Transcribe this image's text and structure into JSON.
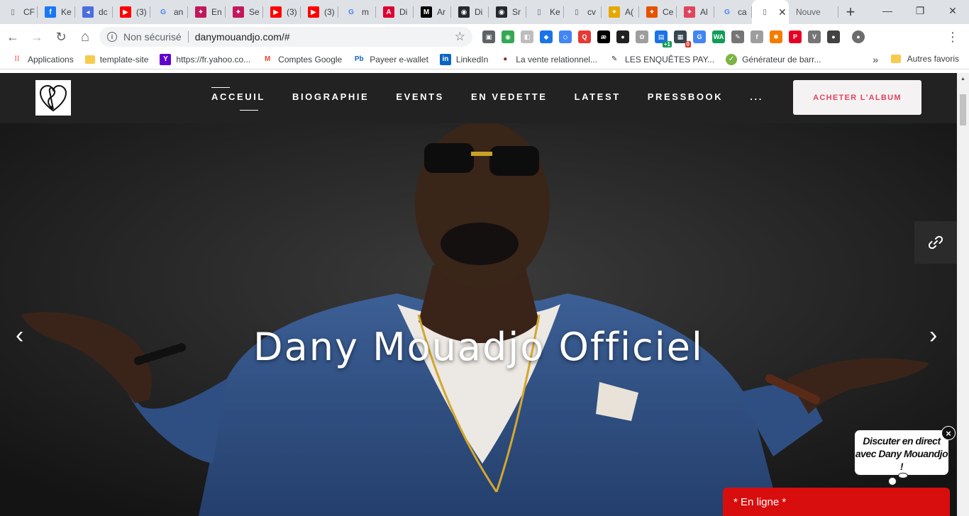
{
  "browser": {
    "tabs": [
      {
        "title": "CF",
        "icon": "page-icon",
        "color": "#5f6368"
      },
      {
        "title": "Ke",
        "icon": "facebook-icon",
        "color": "#1877f2"
      },
      {
        "title": "dc",
        "icon": "dc-icon",
        "color": "#4a6ee0"
      },
      {
        "title": "(3)",
        "icon": "youtube-icon",
        "color": "#ff0000"
      },
      {
        "title": "an",
        "icon": "google-icon",
        "color": "#4285f4"
      },
      {
        "title": "En",
        "icon": "brand-icon",
        "color": "#c2185b"
      },
      {
        "title": "Se",
        "icon": "brand-icon",
        "color": "#c2185b"
      },
      {
        "title": "(3)",
        "icon": "youtube-icon",
        "color": "#ff0000"
      },
      {
        "title": "(3)",
        "icon": "youtube-icon",
        "color": "#ff0000"
      },
      {
        "title": "m",
        "icon": "google-icon",
        "color": "#4285f4"
      },
      {
        "title": "Di",
        "icon": "angular-icon",
        "color": "#dd0031"
      },
      {
        "title": "Ar",
        "icon": "medium-icon",
        "color": "#000000"
      },
      {
        "title": "Di",
        "icon": "github-icon",
        "color": "#24292e"
      },
      {
        "title": "Sr",
        "icon": "github-icon",
        "color": "#24292e"
      },
      {
        "title": "Ke",
        "icon": "page-icon",
        "color": "#5f6368"
      },
      {
        "title": "cv",
        "icon": "page-icon",
        "color": "#5f6368"
      },
      {
        "title": "A(",
        "icon": "brand-icon",
        "color": "#e6a700"
      },
      {
        "title": "Ce",
        "icon": "brand-icon",
        "color": "#e65100"
      },
      {
        "title": "Al",
        "icon": "brand-icon",
        "color": "#e0445e"
      },
      {
        "title": "ca",
        "icon": "google-icon",
        "color": "#4285f4"
      }
    ],
    "active_tab": {
      "title": ""
    },
    "new_tab": {
      "title": "Nouve"
    },
    "new_tab_button": "+",
    "window": {
      "minimize": "—",
      "maximize": "❐",
      "close": "✕"
    },
    "toolbar": {
      "back": "←",
      "forward": "→",
      "reload": "↻",
      "home": "⌂",
      "security_label": "Non sécurisé",
      "url": "danymouandjo.com/#",
      "bookmark_star": "☆",
      "menu": "⋮"
    },
    "extensions": [
      {
        "name": "extension-1-icon",
        "color": "#5f6368",
        "glyph": "▣"
      },
      {
        "name": "extension-2-icon",
        "color": "#34a853",
        "glyph": "◉"
      },
      {
        "name": "extension-3-icon",
        "color": "#bdbdbd",
        "glyph": "◧"
      },
      {
        "name": "extension-4-icon",
        "color": "#1a73e8",
        "glyph": "◆"
      },
      {
        "name": "extension-5-icon",
        "color": "#4285f4",
        "glyph": "◇"
      },
      {
        "name": "extension-6-icon",
        "color": "#e53935",
        "glyph": "Q"
      },
      {
        "name": "extension-7-icon",
        "color": "#000000",
        "glyph": "æ"
      },
      {
        "name": "extension-8-icon",
        "color": "#212121",
        "glyph": "●"
      },
      {
        "name": "extension-9-icon",
        "color": "#9e9e9e",
        "glyph": "✿"
      },
      {
        "name": "extension-10-icon",
        "color": "#1a73e8",
        "glyph": "▤",
        "badge": "+1",
        "badge_color": "#0f9d58"
      },
      {
        "name": "extension-11-icon",
        "color": "#37474f",
        "glyph": "▦",
        "badge": "0",
        "badge_color": "#d93025"
      },
      {
        "name": "extension-12-icon",
        "color": "#4285f4",
        "glyph": "G"
      },
      {
        "name": "extension-13-icon",
        "color": "#0f9d58",
        "glyph": "WA"
      },
      {
        "name": "extension-14-icon",
        "color": "#757575",
        "glyph": "✎"
      },
      {
        "name": "extension-15-icon",
        "color": "#9e9e9e",
        "glyph": "f"
      },
      {
        "name": "extension-16-icon",
        "color": "#f57c00",
        "glyph": "✱"
      },
      {
        "name": "extension-17-icon",
        "color": "#e60023",
        "glyph": "P"
      },
      {
        "name": "extension-18-icon",
        "color": "#757575",
        "glyph": "V"
      },
      {
        "name": "extension-19-icon",
        "color": "#424242",
        "glyph": "●"
      },
      {
        "name": "profile-avatar-icon",
        "color": "#6d6d6d",
        "glyph": "●"
      }
    ],
    "bookmarks": [
      {
        "label": "Applications",
        "icon": "apps-grid-icon"
      },
      {
        "label": "template-site",
        "icon": "folder-icon"
      },
      {
        "label": "https://fr.yahoo.co...",
        "icon": "yahoo-icon"
      },
      {
        "label": "Comptes Google",
        "icon": "gmail-icon"
      },
      {
        "label": "Payeer e-wallet",
        "icon": "payeer-icon"
      },
      {
        "label": "LinkedIn",
        "icon": "linkedin-icon"
      },
      {
        "label": "La vente relationnel...",
        "icon": "site-icon"
      },
      {
        "label": "LES ENQUÊTES PAY...",
        "icon": "survey-icon"
      },
      {
        "label": "Générateur de barr...",
        "icon": "check-icon"
      }
    ],
    "bookmarks_more": "»",
    "bookmarks_other": "Autres favoris"
  },
  "site": {
    "nav": {
      "items": [
        "ACCEUIL",
        "BIOGRAPHIE",
        "EVENTS",
        "EN VEDETTE",
        "LATEST",
        "PRESSBOOK",
        "..."
      ],
      "active_index": 0,
      "cta": "ACHETER L'ALBUM"
    },
    "hero": {
      "title": "Dany Mouadjo Officiel",
      "prev": "‹",
      "next": "›"
    },
    "chat": {
      "bubble_text": "Discuter en direct avec Dany Mouandjo !",
      "close": "×",
      "status": "* En ligne *"
    }
  },
  "colors": {
    "accent": "#e0445e",
    "nav_bg": "#222222",
    "chat_red": "#d80e0e",
    "tabstrip": "#dee1e6"
  }
}
